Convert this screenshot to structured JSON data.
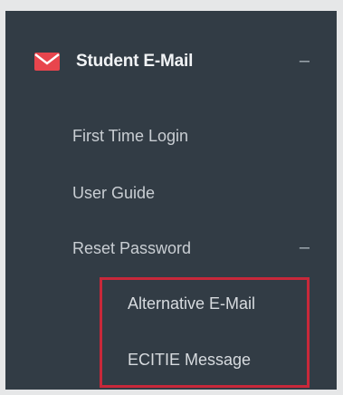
{
  "menu": {
    "header": {
      "label": "Student E-Mail",
      "icon": "envelope-icon",
      "toggle": "–"
    },
    "items": [
      {
        "label": "First Time Login"
      },
      {
        "label": "User Guide"
      },
      {
        "label": "Reset Password",
        "toggle": "–"
      }
    ],
    "submenu": [
      {
        "label": "Alternative E-Mail"
      },
      {
        "label": "ECITIE Message"
      }
    ]
  },
  "colors": {
    "panel": "#323c45",
    "highlight": "#c8283a",
    "icon": "#e8454d"
  }
}
